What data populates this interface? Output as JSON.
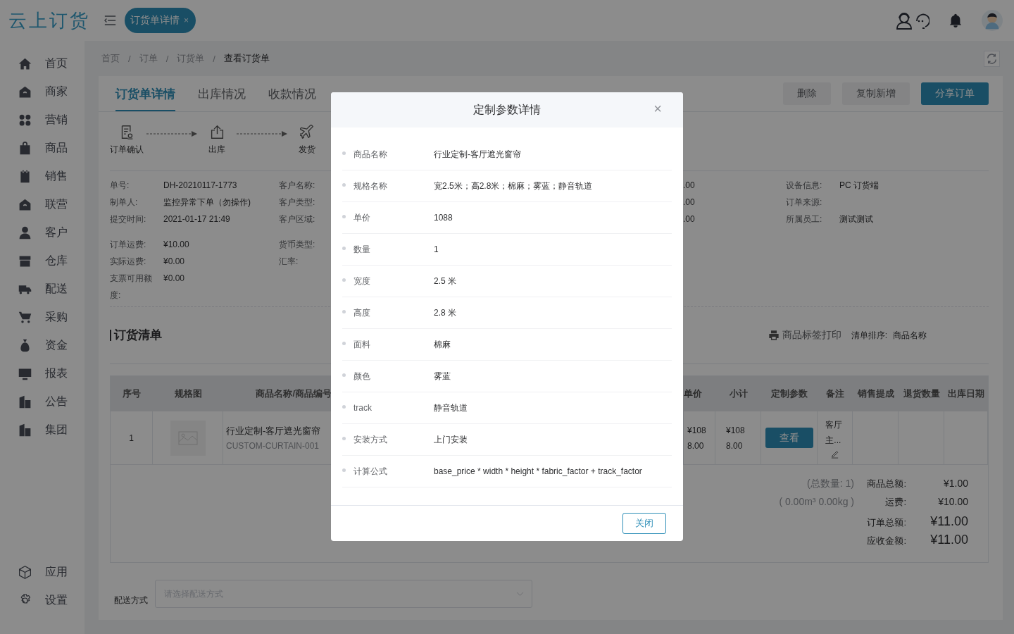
{
  "header": {
    "logo": "云上订货",
    "tab": {
      "label": "订货单详情",
      "close": "×"
    }
  },
  "sidebar": {
    "items": [
      {
        "label": "首页"
      },
      {
        "label": "商家"
      },
      {
        "label": "营销"
      },
      {
        "label": "商品"
      },
      {
        "label": "销售"
      },
      {
        "label": "联营"
      },
      {
        "label": "客户"
      },
      {
        "label": "仓库"
      },
      {
        "label": "配送"
      },
      {
        "label": "采购"
      },
      {
        "label": "资金"
      },
      {
        "label": "报表"
      },
      {
        "label": "公告"
      },
      {
        "label": "集团"
      }
    ],
    "bottom_items": [
      {
        "label": "应用"
      },
      {
        "label": "设置"
      }
    ]
  },
  "breadcrumb": {
    "separator": "/",
    "items": [
      "首页",
      "订单",
      "订货单",
      "查看订货单"
    ]
  },
  "detail_tabs": [
    {
      "label": "订货单详情",
      "selected": true
    },
    {
      "label": "出库情况",
      "selected": false
    },
    {
      "label": "收款情况",
      "selected": false
    }
  ],
  "actions": [
    {
      "label": "删除",
      "kind": "default"
    },
    {
      "label": "复制新增",
      "kind": "default"
    },
    {
      "label": "分享订单",
      "kind": "primary"
    }
  ],
  "steps": [
    {
      "label": "订单确认"
    },
    {
      "label": "出库"
    },
    {
      "label": "发货"
    }
  ],
  "info": {
    "sections": [
      {
        "rows": [
          {
            "cells": [
              {
                "label": "单号:",
                "value": "DH-20210117-1773"
              },
              {
                "label": "客户名称:"
              },
              {
                "value": ".00"
              },
              {
                "label": "设备信息:",
                "value": "PC 订货端"
              }
            ]
          },
          {
            "cells": [
              {
                "label": "制单人:",
                "value": "监控异常下单（勿操作)"
              },
              {
                "label": "客户类型:"
              },
              {
                "value": ".00"
              },
              {
                "label": "订单来源:"
              }
            ]
          },
          {
            "cells": [
              {
                "label": "提交时间:",
                "value": "2021-01-17 21:49"
              },
              {
                "label": "客户区域:"
              },
              {
                "value": ".00"
              },
              {
                "label": "所属员工:",
                "value": "测试测试"
              }
            ]
          }
        ]
      },
      {
        "rows": [
          {
            "cells": [
              {
                "label": "订单运费:",
                "value": "¥10.00"
              },
              {
                "label": "货币类型:"
              }
            ]
          },
          {
            "cells": [
              {
                "label": "实际运费:",
                "value": "¥0.00"
              },
              {
                "label": "汇率:"
              }
            ]
          },
          {
            "cells": [
              {
                "label": "支票可用额度:",
                "value": "¥0.00"
              }
            ]
          }
        ]
      }
    ]
  },
  "order_list": {
    "title": "订货清单",
    "print": "商品标签打印",
    "sort_label": "清单排序:",
    "sort_value": "商品名称",
    "columns": [
      "序号",
      "规格图",
      "商品名称/商品编号",
      "单价",
      "小计",
      "定制参数",
      "备注",
      "销售提成",
      "退货数量",
      "出库日期"
    ],
    "rows": [
      {
        "index": "1",
        "name": "行业定制-客厅遮光窗帘",
        "code": "CUSTOM-CURTAIN-001",
        "unit_price": "¥1088.00",
        "subtotal": "¥1088.00",
        "params_button": "查看",
        "remark": "客厅主..."
      }
    ],
    "summary": [
      {
        "note": "(总数量: 1)",
        "label": "商品总额:",
        "value": "¥1.00",
        "kind": "normal"
      },
      {
        "note": "( 0.00m³ 0.00kg )",
        "label": "运费:",
        "value": "¥10.00",
        "kind": "normal"
      },
      {
        "label": "订单总额:",
        "value": "¥11.00",
        "kind": "large"
      },
      {
        "label": "应收金额:",
        "value": "¥11.00",
        "kind": "large"
      }
    ]
  },
  "delivery": {
    "label": "配送方式",
    "placeholder": "请选择配送方式"
  },
  "modal": {
    "title": "定制参数详情",
    "close": "×",
    "rows": [
      {
        "label": "商品名称",
        "value": "行业定制-客厅遮光窗帘"
      },
      {
        "label": "规格名称",
        "value": "宽2.5米；高2.8米；棉麻；雾蓝；静音轨道"
      },
      {
        "label": "单价",
        "value": "1088"
      },
      {
        "label": "数量",
        "value": "1"
      },
      {
        "label": "宽度",
        "value": "2.5 米"
      },
      {
        "label": "高度",
        "value": "2.8 米"
      },
      {
        "label": "面料",
        "value": "棉麻"
      },
      {
        "label": "颜色",
        "value": "雾蓝"
      },
      {
        "label": "track",
        "value": "静音轨道"
      },
      {
        "label": "安装方式",
        "value": "上门安装"
      },
      {
        "label": "计算公式",
        "value": "base_price * width * height * fabric_factor + track_factor"
      }
    ],
    "button": "关闭"
  }
}
